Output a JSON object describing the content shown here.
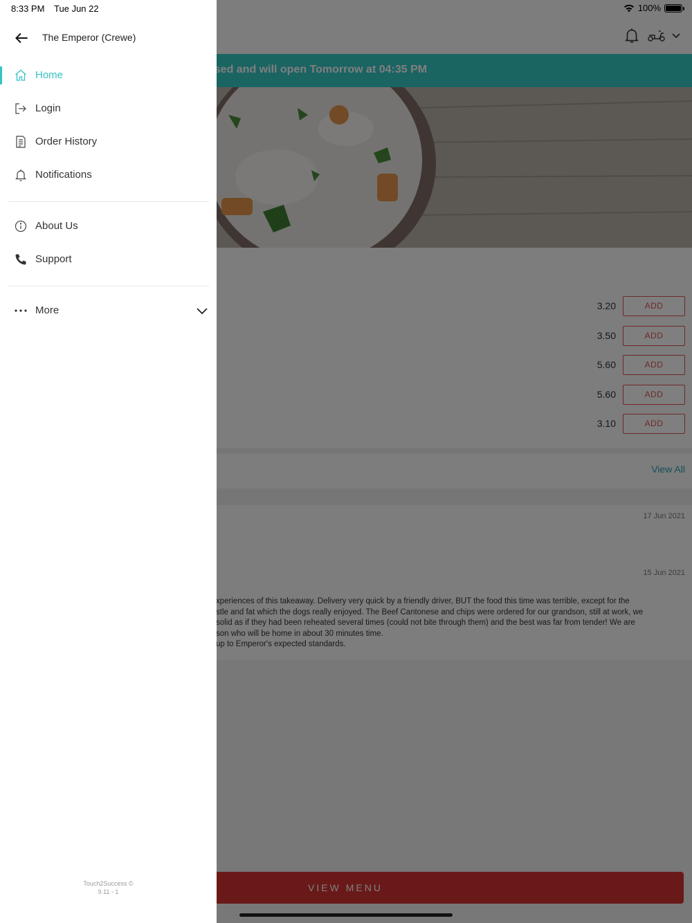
{
  "status_bar": {
    "time": "8:33 PM",
    "date": "Tue Jun 22",
    "battery": "100%"
  },
  "drawer": {
    "store_name": "The Emperor (Crewe)",
    "nav_items": [
      {
        "label": "Home",
        "icon": "home-icon",
        "active": true
      },
      {
        "label": "Login",
        "icon": "login-icon"
      },
      {
        "label": "Order History",
        "icon": "receipt-icon"
      },
      {
        "label": "Notifications",
        "icon": "bell-icon"
      }
    ],
    "info_items": [
      {
        "label": "About Us",
        "icon": "info-icon"
      },
      {
        "label": "Support",
        "icon": "phone-icon"
      }
    ],
    "more": {
      "label": "More",
      "icon": "more-dots-icon"
    },
    "footer": {
      "brand": "Touch2Success ©",
      "version": "9.11 - 1"
    }
  },
  "background": {
    "banner": "osed and will open Tomorrow at 04:35 PM",
    "items": [
      {
        "price": "3.20",
        "add_label": "ADD"
      },
      {
        "price": "3.50",
        "add_label": "ADD"
      },
      {
        "price": "5.60",
        "add_label": "ADD"
      },
      {
        "price": "5.60",
        "add_label": "ADD"
      },
      {
        "price": "3.10",
        "add_label": "ADD"
      }
    ],
    "view_all": "View All",
    "reviews": [
      {
        "date": "17 Jun 2021"
      },
      {
        "date": "15 Jun 2021",
        "lines": [
          "xperiences of this takeaway. Delivery very quick by a friendly driver, BUT the food this time was terrible, except for the",
          "stle and fat which the dogs really enjoyed. The Beef Cantonese and chips were ordered for our grandson, still at work, we",
          "solid as if they had been reheated several times (could not bite through them) and the best was far from tender! We are",
          "son who will be home in about 30 minutes time.",
          "up to Emperor's expected standards."
        ]
      }
    ],
    "view_menu": "VIEW MENU"
  },
  "colors": {
    "accent": "#35c4c4",
    "brand_red": "#d43333",
    "banner": "#35c9c4"
  }
}
